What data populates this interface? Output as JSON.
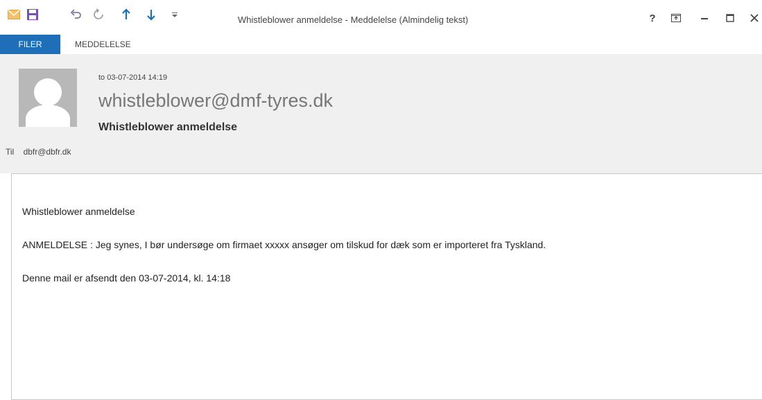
{
  "window": {
    "title": "Whistleblower anmeldelse - Meddelelse (Almindelig tekst)",
    "help_label": "?",
    "accent_color": "#1e6fb8"
  },
  "quick_access": {
    "icons": [
      "envelope-icon",
      "save-icon",
      "undo-icon",
      "redo-icon",
      "previous-item-icon",
      "next-item-icon",
      "customize-toolbar-icon"
    ]
  },
  "ribbon": {
    "tabs": [
      {
        "label": "FILER",
        "active": true
      },
      {
        "label": "MEDDELELSE",
        "active": false
      }
    ]
  },
  "message": {
    "date": "to 03-07-2014 14:19",
    "sender": "whistleblower@dmf-tyres.dk",
    "subject": "Whistleblower anmeldelse",
    "to_label": "Til",
    "to_address": "dbfr@dbfr.dk",
    "body_lines": [
      "Whistleblower anmeldelse",
      "ANMELDELSE : Jeg synes, I bør undersøge om firmaet xxxxx ansøger om tilskud for dæk som er importeret fra Tyskland.",
      "Denne mail er afsendt den 03-07-2014, kl. 14:18"
    ]
  }
}
